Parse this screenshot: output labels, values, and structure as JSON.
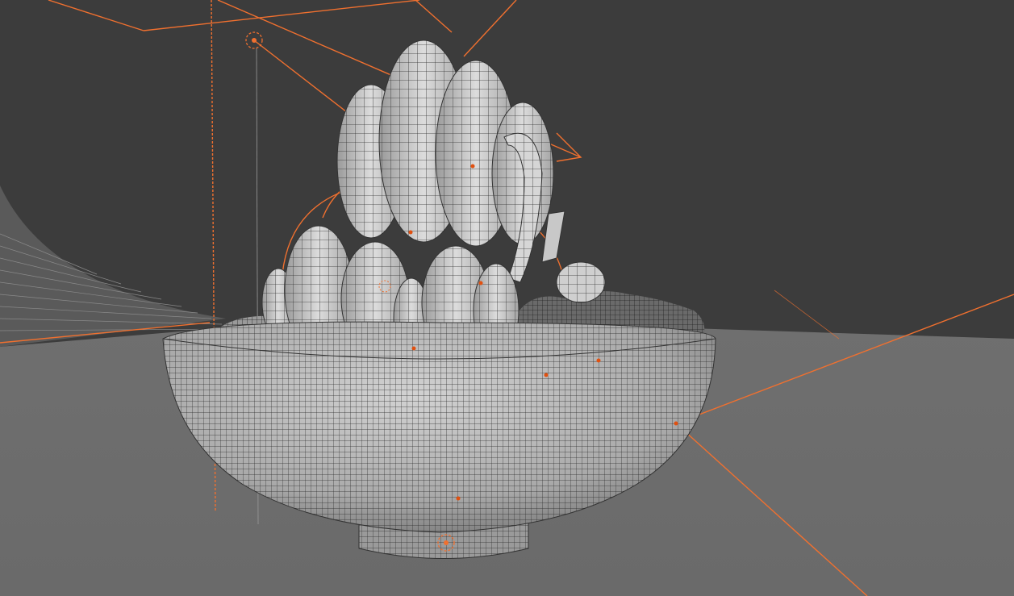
{
  "viewport": {
    "mode": "3d-wireframe-overlay",
    "colors": {
      "background": "#3c3c3c",
      "floor": "#6e6e6e",
      "mesh_fill": "#c4c4c4",
      "mesh_wire": "#2a2a2a",
      "selection": "#f0702f",
      "origin_dot": "#e05010"
    },
    "objects": [
      "bowl-mesh",
      "swirl-pasta-mesh",
      "food-clump-mesh",
      "camera-lines",
      "light-emitter"
    ]
  }
}
